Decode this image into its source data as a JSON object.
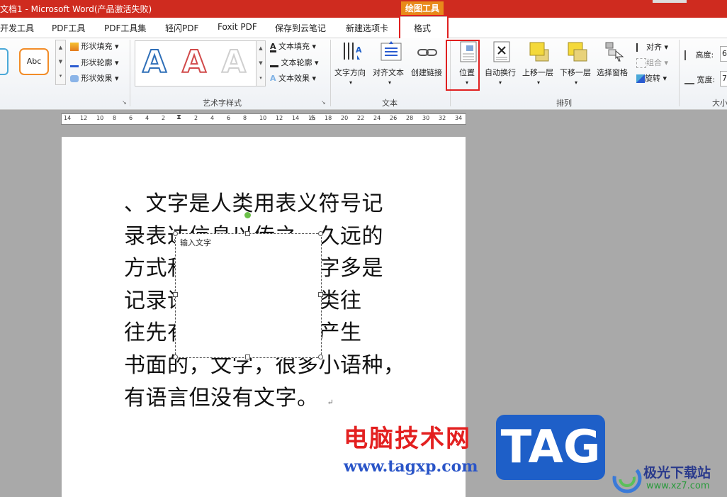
{
  "titlebar": {
    "title": "文档1 - Microsoft Word(产品激活失败)",
    "context_tab": "绘图工具"
  },
  "tabs": [
    "开发工具",
    "PDF工具",
    "PDF工具集",
    "轻闪PDF",
    "Foxit PDF",
    "保存到云笔记",
    "新建选项卡",
    "格式"
  ],
  "ribbon": {
    "shape_style": {
      "sample_label": "Abc",
      "fill": "形状填充",
      "outline": "形状轮廓",
      "effect": "形状效果"
    },
    "wordart": {
      "group_label": "艺术字样式",
      "letter": "A",
      "text_fill": "文本填充",
      "text_outline": "文本轮廓",
      "text_effect": "文本效果"
    },
    "text": {
      "group_label": "文本",
      "direction": "文字方向",
      "align": "对齐文本",
      "link": "创建链接"
    },
    "arrange": {
      "group_label": "排列",
      "position": "位置",
      "wrap": "自动换行",
      "forward": "上移一层",
      "backward": "下移一层",
      "pane": "选择窗格",
      "align": "对齐",
      "group": "组合",
      "rotate": "旋转"
    },
    "size": {
      "group_label": "大小",
      "height": "高度:",
      "height_value": "6",
      "width": "宽度:",
      "width_value": "7"
    }
  },
  "ruler": [
    "14",
    "12",
    "10",
    "8",
    "6",
    "4",
    "2",
    "",
    "2",
    "4",
    "6",
    "8",
    "10",
    "12",
    "14",
    "16",
    "18",
    "20",
    "22",
    "24",
    "26",
    "28",
    "30",
    "32",
    "34"
  ],
  "document": {
    "lines": [
      "、文字是人类用表义符号记",
      "录表达信息以传之，久远的",
      "方式和工具。现代文字多是",
      "记录语言的工具。人类往",
      "往先有口头的语言后产生",
      "书面的，文字，很多小语种，",
      "有语言但没有文字。"
    ],
    "paragraph_mark": "↵",
    "textbox_text": "输入文字"
  },
  "watermark": {
    "site_name": "电脑技术网",
    "site_url": "www.tagxp.com",
    "tag": "TAG",
    "logo_name": "极光下载站",
    "logo_url": "www.xz7.com"
  }
}
